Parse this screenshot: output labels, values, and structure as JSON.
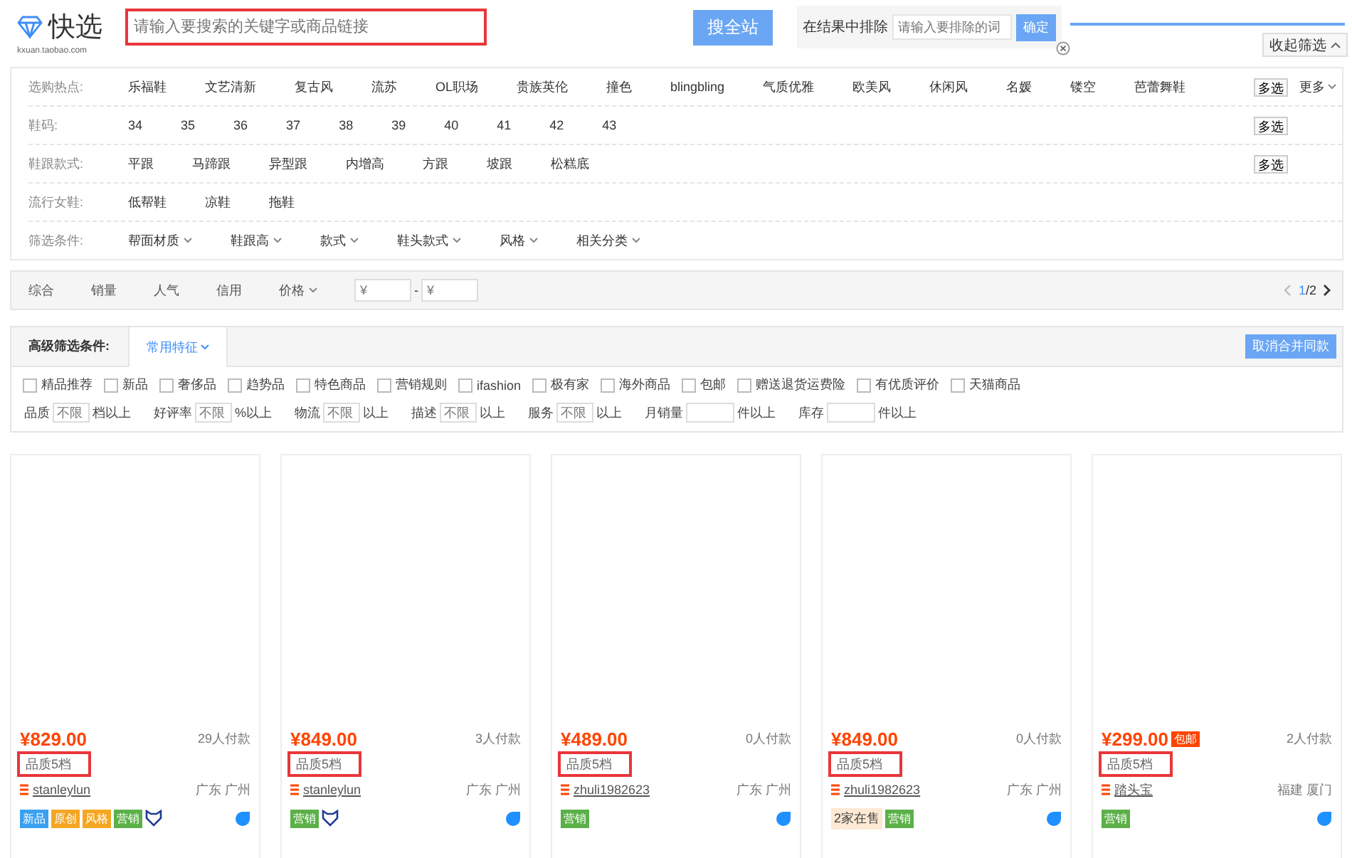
{
  "header": {
    "logo_text": "快选",
    "logo_domain": "kxuan.taobao.com",
    "search": {
      "placeholder": "请输入要搜索的关键字或商品链接",
      "highlighted": true
    },
    "search_button": "搜全站",
    "exclude": {
      "label": "在结果中排除",
      "placeholder": "请输入要排除的词",
      "button": "确定"
    },
    "collapse_button": "收起筛选"
  },
  "filters": [
    {
      "label": "选购热点:",
      "kind": "links",
      "values": [
        "乐福鞋",
        "文艺清新",
        "复古风",
        "流苏",
        "OL职场",
        "贵族英伦",
        "撞色",
        "blingbling",
        "气质优雅",
        "欧美风",
        "休闲风",
        "名媛",
        "镂空",
        "芭蕾舞鞋"
      ],
      "multi": "多选",
      "more": "更多"
    },
    {
      "label": "鞋码:",
      "kind": "links",
      "values": [
        "34",
        "35",
        "36",
        "37",
        "38",
        "39",
        "40",
        "41",
        "42",
        "43"
      ],
      "multi": "多选"
    },
    {
      "label": "鞋跟款式:",
      "kind": "links",
      "values": [
        "平跟",
        "马蹄跟",
        "异型跟",
        "内增高",
        "方跟",
        "坡跟",
        "松糕底"
      ],
      "multi": "多选"
    },
    {
      "label": "流行女鞋:",
      "kind": "links",
      "values": [
        "低帮鞋",
        "凉鞋",
        "拖鞋"
      ]
    },
    {
      "label": "筛选条件:",
      "kind": "dropdowns",
      "values": [
        "帮面材质",
        "鞋跟高",
        "款式",
        "鞋头款式",
        "风格",
        "相关分类"
      ]
    }
  ],
  "sort_bar": {
    "items": [
      {
        "label": "综合",
        "kind": "plain"
      },
      {
        "label": "销量",
        "kind": "plain"
      },
      {
        "label": "人气",
        "kind": "plain"
      },
      {
        "label": "信用",
        "kind": "plain"
      },
      {
        "label": "价格",
        "kind": "dropdown"
      }
    ],
    "price_from": {
      "placeholder": "¥"
    },
    "price_separator": "-",
    "price_to": {
      "placeholder": "¥"
    },
    "page_current": "1",
    "page_total": "/2"
  },
  "advanced": {
    "title": "高级筛选条件:",
    "tab": "常用特征",
    "button": "取消合并同款",
    "checkboxes": [
      {
        "label": "精品推荐",
        "checked": false
      },
      {
        "label": "新品",
        "checked": false
      },
      {
        "label": "奢侈品",
        "checked": false
      },
      {
        "label": "趋势品",
        "checked": false
      },
      {
        "label": "特色商品",
        "checked": false
      },
      {
        "label": "营销规则",
        "checked": false
      },
      {
        "label": "ifashion",
        "checked": false
      },
      {
        "label": "极有家",
        "checked": false
      },
      {
        "label": "海外商品",
        "checked": false
      },
      {
        "label": "包邮",
        "checked": false
      },
      {
        "label": "赠送退货运费险",
        "checked": false
      },
      {
        "label": "有优质评价",
        "checked": false
      },
      {
        "label": "天猫商品",
        "checked": false
      }
    ],
    "ranges": [
      {
        "label": "品质",
        "placeholder": "不限",
        "suffix": "档以上"
      },
      {
        "label": "好评率",
        "placeholder": "不限",
        "suffix": "%以上"
      },
      {
        "label": "物流",
        "placeholder": "不限",
        "suffix": "以上"
      },
      {
        "label": "描述",
        "placeholder": "不限",
        "suffix": "以上"
      },
      {
        "label": "服务",
        "placeholder": "不限",
        "suffix": "以上"
      },
      {
        "label": "月销量",
        "suffix": "件以上"
      },
      {
        "label": "库存",
        "suffix": "件以上"
      }
    ]
  },
  "products": [
    {
      "price": "¥829.00",
      "sales": "29人付款",
      "quality": "品质5档",
      "quality_highlighted": true,
      "shop": "stanleylun",
      "location": "广东 广州",
      "tags": [
        {
          "text": "新品",
          "kind": "new"
        },
        {
          "text": "原创",
          "kind": "original"
        },
        {
          "text": "风格",
          "kind": "original"
        },
        {
          "text": "营销",
          "kind": "promo"
        },
        {
          "kind": "shield"
        }
      ]
    },
    {
      "price": "¥849.00",
      "sales": "3人付款",
      "quality": "品质5档",
      "quality_highlighted": true,
      "shop": "stanleylun",
      "location": "广东 广州",
      "tags": [
        {
          "text": "营销",
          "kind": "promo"
        },
        {
          "kind": "shield"
        }
      ]
    },
    {
      "price": "¥489.00",
      "sales": "0人付款",
      "quality": "品质5档",
      "quality_highlighted": true,
      "shop": "zhuli1982623",
      "location": "广东 广州",
      "tags": [
        {
          "text": "营销",
          "kind": "promo"
        }
      ]
    },
    {
      "price": "¥849.00",
      "sales": "0人付款",
      "quality": "品质5档",
      "quality_highlighted": true,
      "shop": "zhuli1982623",
      "location": "广东 广州",
      "tags": [
        {
          "text": "2家在售",
          "kind": "sellers"
        },
        {
          "text": "营销",
          "kind": "promo"
        }
      ]
    },
    {
      "price": "¥299.00",
      "badge": "包邮",
      "sales": "2人付款",
      "quality": "品质5档",
      "quality_highlighted": true,
      "shop": "踏头宝",
      "location": "福建 厦门",
      "tags": [
        {
          "text": "营销",
          "kind": "promo"
        }
      ]
    }
  ]
}
